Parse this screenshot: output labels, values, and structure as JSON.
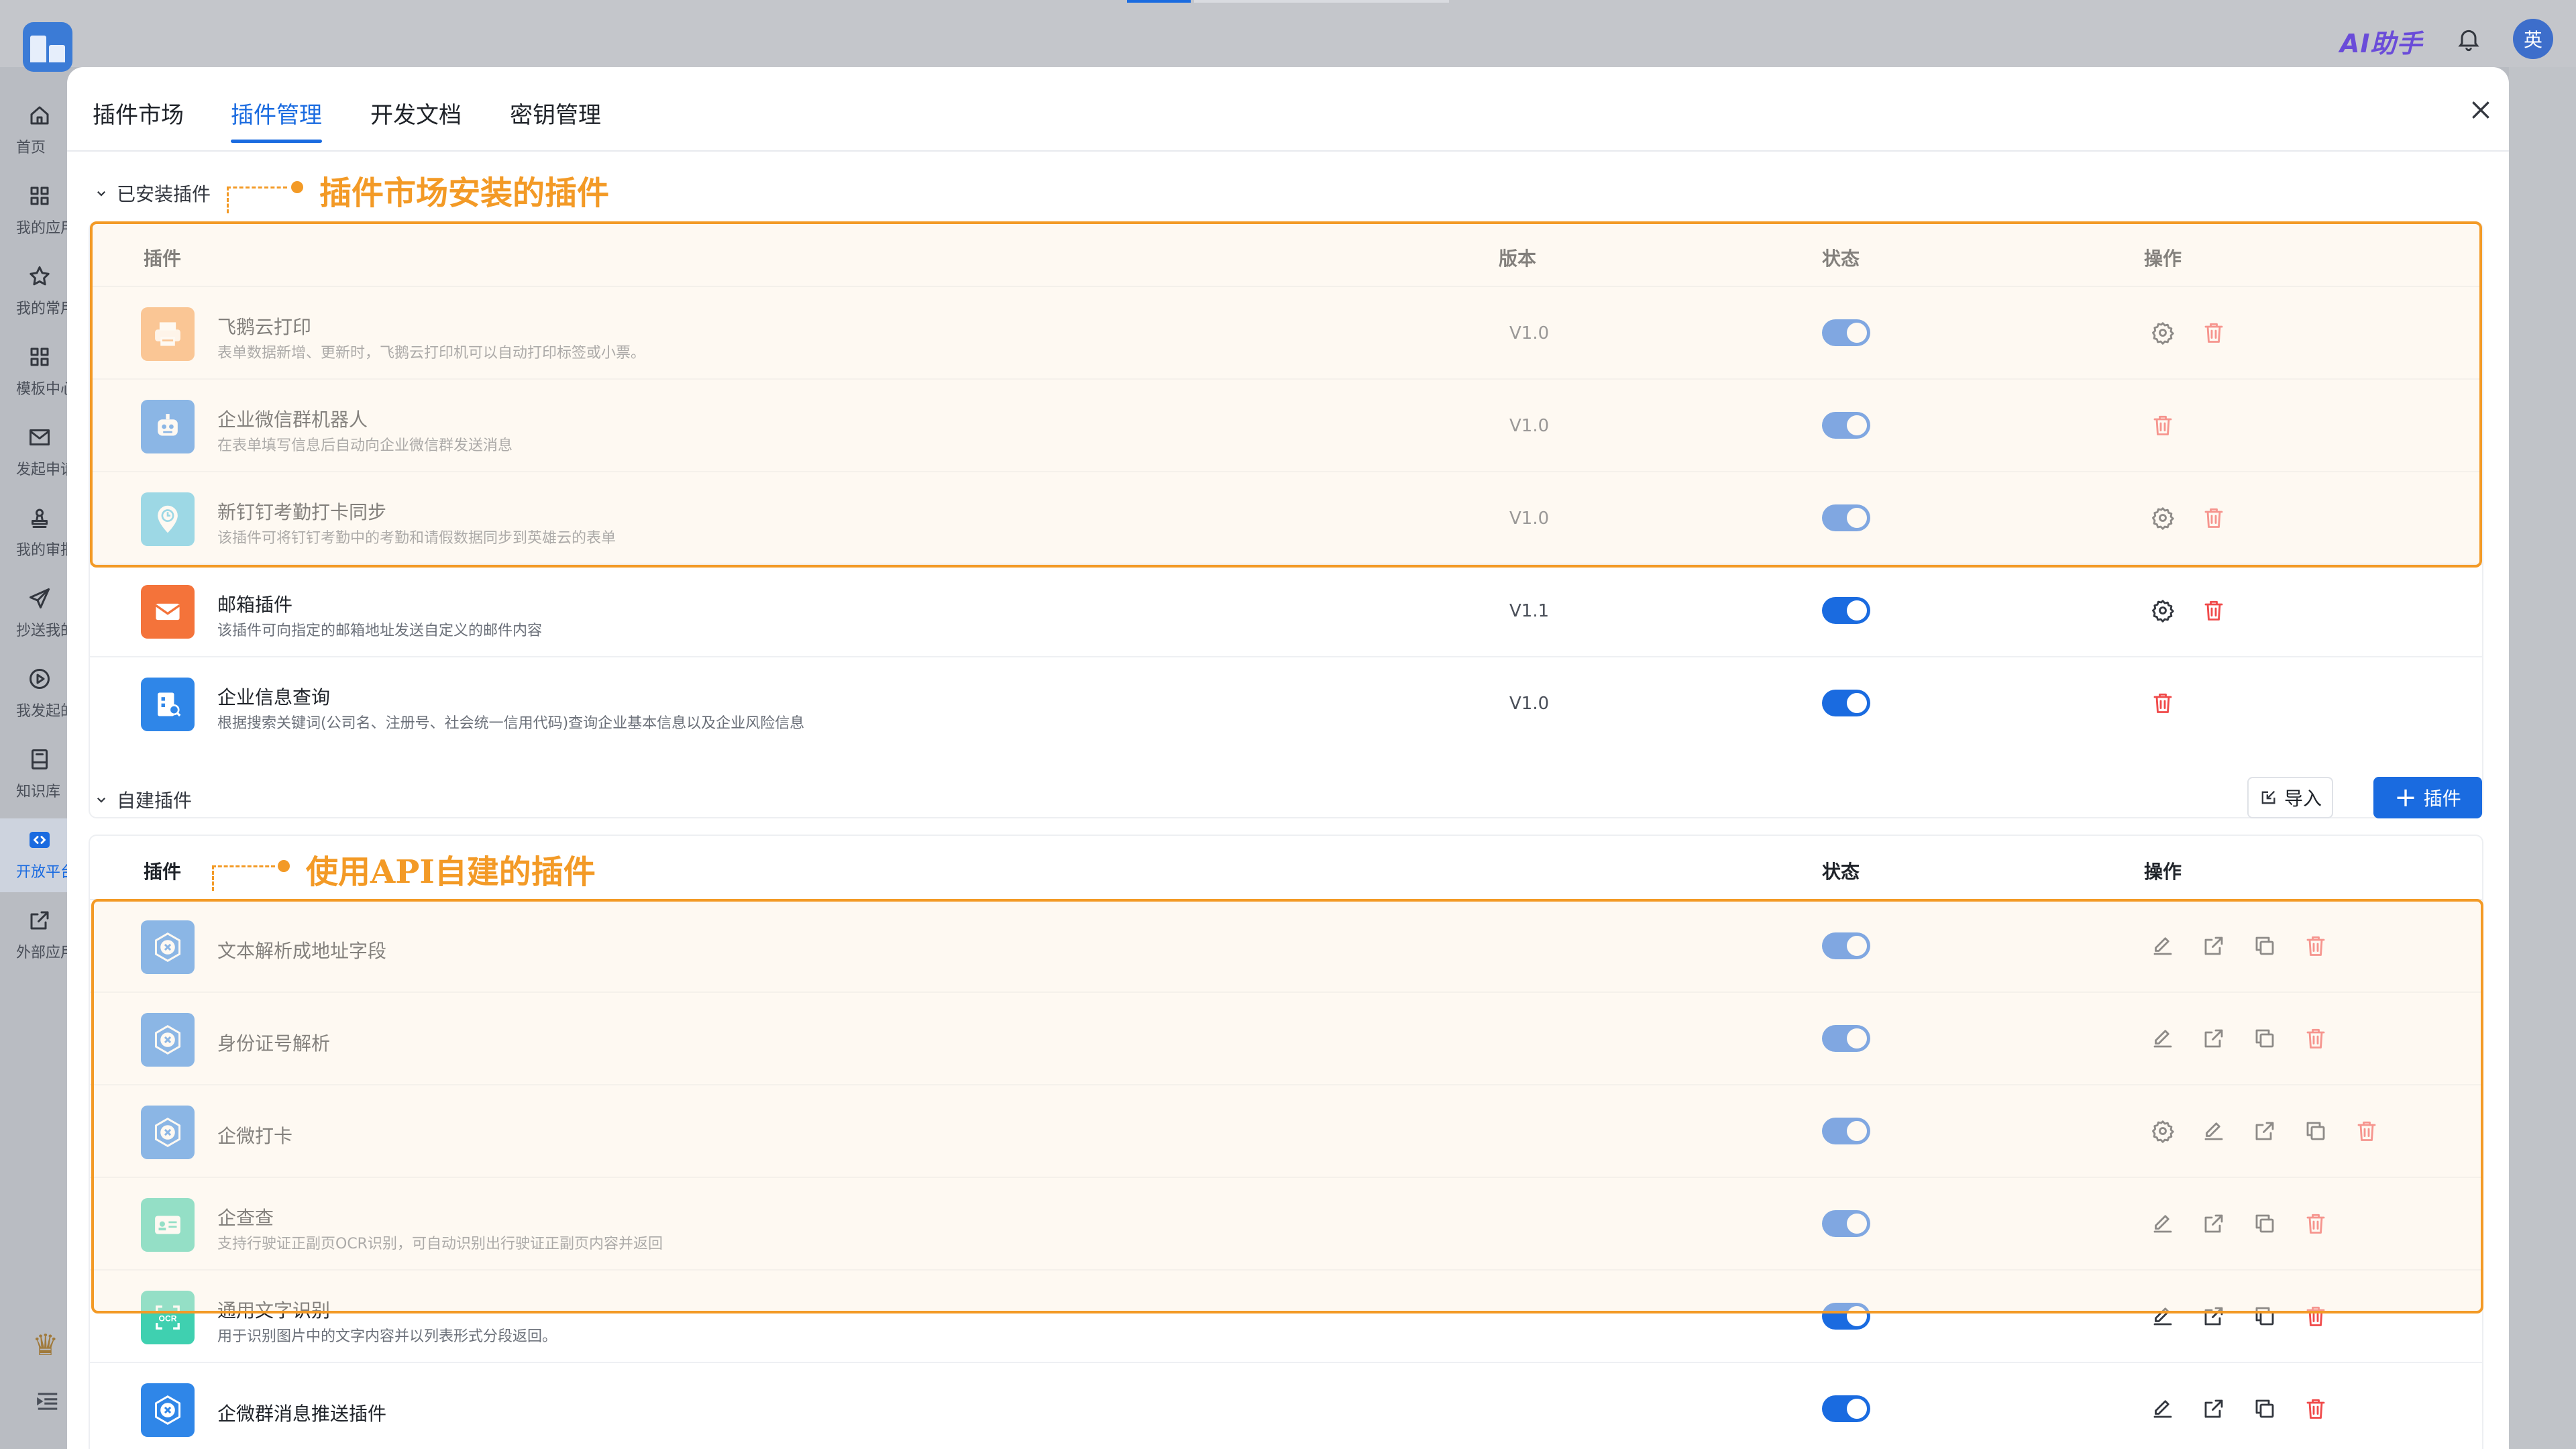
{
  "topbar": {
    "ai_label": "AI助手",
    "avatar_text": "英"
  },
  "sidebar": {
    "items": [
      {
        "label": "首页",
        "icon": "home-icon"
      },
      {
        "label": "我的应用",
        "icon": "apps-icon"
      },
      {
        "label": "我的常用",
        "icon": "star-icon"
      },
      {
        "label": "模板中心",
        "icon": "template-icon"
      },
      {
        "label": "发起申请",
        "icon": "mail-icon"
      },
      {
        "label": "我的审批",
        "icon": "stamp-icon"
      },
      {
        "label": "抄送我的",
        "icon": "send-icon"
      },
      {
        "label": "我发起的",
        "icon": "play-icon"
      },
      {
        "label": "知识库",
        "icon": "book-icon"
      },
      {
        "label": "开放平台",
        "icon": "code-icon",
        "active": true
      },
      {
        "label": "外部应用",
        "icon": "external-icon"
      }
    ]
  },
  "tabs": [
    {
      "label": "插件市场",
      "active": false
    },
    {
      "label": "插件管理",
      "active": true
    },
    {
      "label": "开发文档",
      "active": false
    },
    {
      "label": "密钥管理",
      "active": false
    }
  ],
  "installed": {
    "title": "已安装插件",
    "annotation": "插件市场安装的插件",
    "headers": {
      "plugin": "插件",
      "version": "版本",
      "status": "状态",
      "action": "操作"
    },
    "rows": [
      {
        "name": "飞鹅云打印",
        "desc": "表单数据新增、更新时，飞鹅云打印机可以自动打印标签或小票。",
        "version": "V1.0",
        "enabled": true,
        "actions": [
          "settings",
          "delete"
        ],
        "icon": "printer-icon",
        "color": "#f7a356"
      },
      {
        "name": "企业微信群机器人",
        "desc": "在表单填写信息后自动向企业微信群发送消息",
        "version": "V1.0",
        "enabled": true,
        "actions": [
          "delete"
        ],
        "icon": "robot-icon",
        "color": "#2f86e8"
      },
      {
        "name": "新钉钉考勤打卡同步",
        "desc": "该插件可将钉钉考勤中的考勤和请假数据同步到英雄云的表单",
        "version": "V1.0",
        "enabled": true,
        "actions": [
          "settings",
          "delete"
        ],
        "icon": "clock-pin-icon",
        "color": "#4fc3e8"
      },
      {
        "name": "邮箱插件",
        "desc": "该插件可向指定的邮箱地址发送自定义的邮件内容",
        "version": "V1.1",
        "enabled": true,
        "actions": [
          "settings",
          "delete"
        ],
        "icon": "envelope-icon",
        "color": "#f4733a"
      },
      {
        "name": "企业信息查询",
        "desc": "根据搜索关键词(公司名、注册号、社会统一信用代码)查询企业基本信息以及企业风险信息",
        "version": "V1.0",
        "enabled": true,
        "actions": [
          "delete"
        ],
        "icon": "building-search-icon",
        "color": "#2f86e8"
      }
    ]
  },
  "custom": {
    "title": "自建插件",
    "annotation": "使用API自建的插件",
    "import_label": "导入",
    "add_label": "插件",
    "headers": {
      "plugin": "插件",
      "status": "状态",
      "action": "操作"
    },
    "rows": [
      {
        "name": "文本解析成地址字段",
        "desc": "",
        "enabled": true,
        "actions": [
          "edit",
          "open",
          "copy",
          "delete"
        ],
        "icon": "plugin-badge-icon",
        "color": "#2f86e8"
      },
      {
        "name": "身份证号解析",
        "desc": "",
        "enabled": true,
        "actions": [
          "edit",
          "open",
          "copy",
          "delete"
        ],
        "icon": "plugin-badge-icon",
        "color": "#2f86e8"
      },
      {
        "name": "企微打卡",
        "desc": "",
        "enabled": true,
        "actions": [
          "settings",
          "edit",
          "open",
          "copy",
          "delete"
        ],
        "icon": "plugin-badge-icon",
        "color": "#2f86e8"
      },
      {
        "name": "企查查",
        "desc": "支持行驶证正副页OCR识别，可自动识别出行驶证正副页内容并返回",
        "enabled": true,
        "actions": [
          "edit",
          "open",
          "copy",
          "delete"
        ],
        "icon": "id-card-icon",
        "color": "#3fd0b0"
      },
      {
        "name": "通用文字识别",
        "desc": "用于识别图片中的文字内容并以列表形式分段返回。",
        "enabled": true,
        "actions": [
          "edit",
          "open",
          "copy",
          "delete"
        ],
        "icon": "ocr-icon",
        "color": "#3fd0b0"
      },
      {
        "name": "企微群消息推送插件",
        "desc": "",
        "enabled": true,
        "actions": [
          "edit",
          "open",
          "copy",
          "delete"
        ],
        "icon": "plugin-badge-icon",
        "color": "#2f86e8"
      }
    ]
  }
}
